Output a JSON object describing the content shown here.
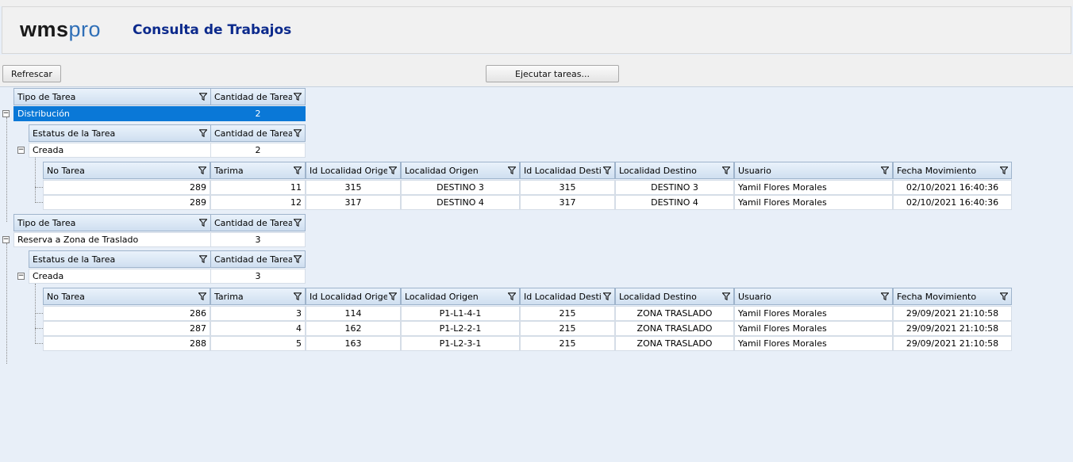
{
  "app": {
    "logo_left": "wms",
    "logo_right": "pro",
    "title": "Consulta de Trabajos"
  },
  "toolbar": {
    "refresh_label": "Refrescar",
    "execute_label": "Ejecutar tareas..."
  },
  "headers": {
    "tipo": "Tipo de Tarea",
    "cantidad": "Cantidad de Tarea",
    "estatus": "Estatus de la Tarea",
    "detail": [
      "No Tarea",
      "Tarima",
      "Id Localidad Origen",
      "Localidad Origen",
      "Id Localidad Destin",
      "Localidad Destino",
      "Usuario",
      "Fecha Movimiento"
    ]
  },
  "groups": [
    {
      "tipo": "Distribución",
      "cantidad": "2",
      "estatus": "Creada",
      "estatus_cantidad": "2",
      "rows": [
        [
          "289",
          "11",
          "315",
          "DESTINO 3",
          "315",
          "DESTINO 3",
          "Yamil Flores Morales",
          "02/10/2021 16:40:36"
        ],
        [
          "289",
          "12",
          "317",
          "DESTINO 4",
          "317",
          "DESTINO 4",
          "Yamil Flores Morales",
          "02/10/2021 16:40:36"
        ]
      ]
    },
    {
      "tipo": "Reserva a Zona de Traslado",
      "cantidad": "3",
      "estatus": "Creada",
      "estatus_cantidad": "3",
      "rows": [
        [
          "286",
          "3",
          "114",
          "P1-L1-4-1",
          "215",
          "ZONA TRASLADO",
          "Yamil Flores Morales",
          "29/09/2021 21:10:58"
        ],
        [
          "287",
          "4",
          "162",
          "P1-L2-2-1",
          "215",
          "ZONA TRASLADO",
          "Yamil Flores Morales",
          "29/09/2021 21:10:58"
        ],
        [
          "288",
          "5",
          "163",
          "P1-L2-3-1",
          "215",
          "ZONA TRASLADO",
          "Yamil Flores Morales",
          "29/09/2021 21:10:58"
        ]
      ]
    }
  ]
}
